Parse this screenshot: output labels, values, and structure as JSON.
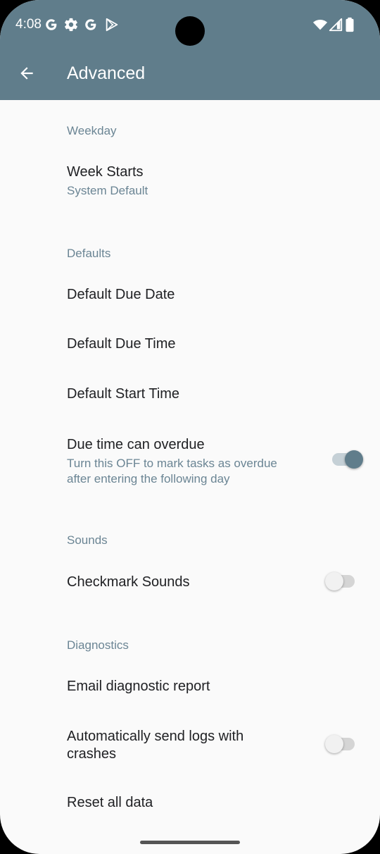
{
  "status_bar": {
    "time": "4:08",
    "left_icons": [
      "google-g-icon",
      "settings-gear-icon",
      "google-g-icon",
      "play-store-icon"
    ],
    "right_icons": [
      "wifi-icon",
      "cell-signal-icon",
      "battery-icon"
    ]
  },
  "app_bar": {
    "title": "Advanced",
    "back_icon": "arrow-back-icon",
    "color": "#607d8b"
  },
  "sections": {
    "weekday": {
      "header": "Weekday",
      "week_starts": {
        "title": "Week Starts",
        "summary": "System Default"
      }
    },
    "defaults": {
      "header": "Defaults",
      "due_date": {
        "title": "Default Due Date"
      },
      "due_time": {
        "title": "Default Due Time"
      },
      "start_time": {
        "title": "Default Start Time"
      },
      "overdue": {
        "title": "Due time can overdue",
        "summary_line1": "Turn this OFF to mark tasks as overdue",
        "summary_line2": "after entering the following day",
        "enabled": true
      }
    },
    "sounds": {
      "header": "Sounds",
      "checkmark": {
        "title": "Checkmark Sounds",
        "enabled": false
      }
    },
    "diagnostics": {
      "header": "Diagnostics",
      "email": {
        "title": "Email diagnostic report"
      },
      "auto_logs": {
        "title_line1": "Automatically send logs with",
        "title_line2": "crashes",
        "enabled": false
      },
      "reset": {
        "title": "Reset all data"
      }
    }
  },
  "colors": {
    "accent": "#607d8b",
    "section_header": "#6b8594",
    "background": "#fafafa"
  }
}
